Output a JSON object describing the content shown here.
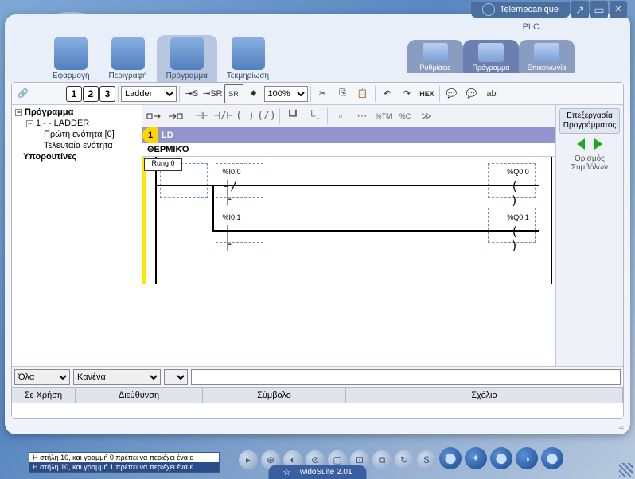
{
  "brand": "Telemecanique",
  "plc_label": "PLC",
  "footer": "TwidoSuite 2.01",
  "nav": {
    "app": "Εφαρμογή",
    "desc": "Περιγραφή",
    "prog": "Πρόγραμμα",
    "doc": "Τεκμηρίωση"
  },
  "subnav": {
    "settings": "Ρυθμίσεις",
    "program": "Πρόγραμμα",
    "comm": "Επικοινωνία"
  },
  "toolbar": {
    "view_select": "Ladder",
    "zoom": "100%",
    "hex": "HEX",
    "nums": [
      "1",
      "2",
      "3"
    ]
  },
  "tree": {
    "root": "Πρόγραμμα",
    "n1": "1 -  - LADDER",
    "n1a": "Πρώτη ενότητα [0]",
    "n1b": "Τελευταία ενότητα",
    "subs": "Υπορουτίνες"
  },
  "editor": {
    "section_num": "1",
    "section_lang": "LD",
    "title": "ΘΕΡΜΙΚΌ",
    "rung": "Rung 0",
    "i0": "%I0.0",
    "i1": "%I0.1",
    "q0": "%Q0.0",
    "q1": "%Q0.1"
  },
  "rightpanel": {
    "edit": "Επεξεργασία Προγράμματος",
    "symdef": "Ορισμός Συμβόλων"
  },
  "filters": {
    "all": "Όλα",
    "none": "Κανένα"
  },
  "grid": {
    "inuse": "Σε Χρήση",
    "address": "Διεύθυνση",
    "symbol": "Σύμβολο",
    "comment": "Σχόλιο"
  },
  "messages": {
    "m1": "Η στήλη 10, και γραμμή 0 πρέπει να περιέχει ένα ε",
    "m2": "Η στήλη 10, και γραμμή 1 πρέπει να περιέχει ένα ε"
  }
}
